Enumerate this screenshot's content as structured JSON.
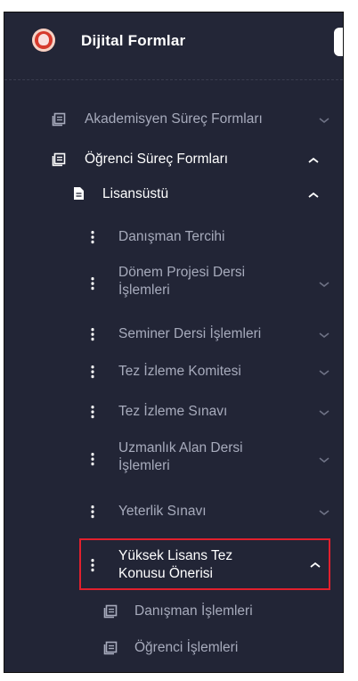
{
  "header": {
    "title": "Dijital Formlar"
  },
  "menu": {
    "akademisyen": "Akademisyen Süreç Formları",
    "ogrenci": "Öğrenci Süreç Formları",
    "lisansustu": "Lisansüstü",
    "items": [
      "Danışman Tercihi",
      "Dönem Projesi Dersi İşlemleri",
      "Seminer Dersi İşlemleri",
      "Tez İzleme Komitesi",
      "Tez İzleme Sınavı",
      "Uzmanlık Alan Dersi İşlemleri",
      "Yeterlik Sınavı",
      "Yüksek Lisans Tez Konusu Önerisi"
    ],
    "subitems": [
      "Danışman İşlemleri",
      "Öğrenci İşlemleri"
    ]
  },
  "colors": {
    "sidebar_bg": "#222536",
    "text_muted": "#a7abbc",
    "text_active": "#ffffff",
    "highlight_border": "#e2202d"
  }
}
